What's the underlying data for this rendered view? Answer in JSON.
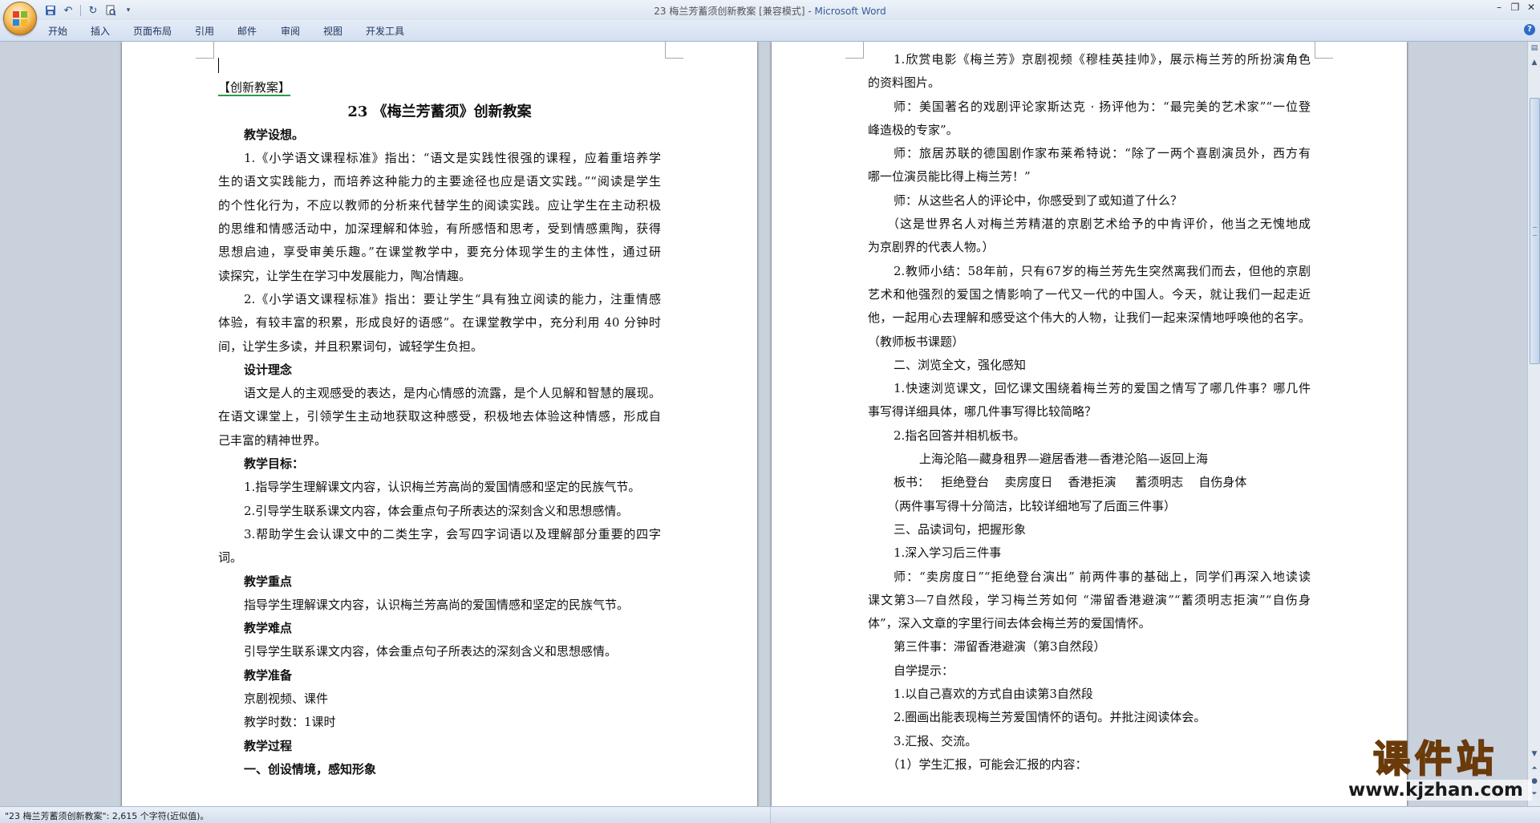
{
  "window": {
    "title": "23 梅兰芳蓄须创新教案 [兼容模式]",
    "app_name": "Microsoft Word"
  },
  "quick_access": [
    "save-icon",
    "undo-icon",
    "redo-icon",
    "print-preview-icon",
    "customize-icon"
  ],
  "ribbon": {
    "tabs": [
      "开始",
      "插入",
      "页面布局",
      "引用",
      "邮件",
      "审阅",
      "视图",
      "开发工具"
    ]
  },
  "page1": {
    "lines": [
      "【创新教案】",
      "23 《梅兰芳蓄须》创新教案",
      "教学设想。",
      "1.《小学语文课程标准》指出：“语文是实践性很强的课程，应着重培养学",
      "生的语文实践能力，而培养这种能力的主要途径也应是语文实践。”“阅读是学生",
      "的个性化行为，不应以教师的分析来代替学生的阅读实践。应让学生在主动积极",
      "的思维和情感活动中，加深理解和体验，有所感悟和思考，受到情感熏陶，获得",
      "思想启迪，享受审美乐趣。”在课堂教学中，要充分体现学生的主体性，通过研",
      "读探究，让学生在学习中发展能力，陶冶情趣。",
      "2.《小学语文课程标准》指出：要让学生“具有独立阅读的能力，注重情感",
      "体验，有较丰富的积累，形成良好的语感”。在课堂教学中，充分利用 40 分钟时",
      "间，让学生多读，并且积累词句，诚轻学生负担。",
      "设计理念",
      "语文是人的主观感受的表达，是内心情感的流露，是个人见解和智慧的展现。",
      "在语文课堂上，引领学生主动地获取这种感受，积极地去体验这种情感，形成自",
      "己丰富的精神世界。",
      "教学目标：",
      "1.指导学生理解课文内容，认识梅兰芳高尚的爱国情感和坚定的民族气节。",
      "2.引导学生联系课文内容，体会重点句子所表达的深刻含义和思想感情。",
      "3.帮助学生会认课文中的二类生字，会写四字词语以及理解部分重要的四字",
      "词。",
      "教学重点",
      "指导学生理解课文内容，认识梅兰芳高尚的爱国情感和坚定的民族气节。",
      "教学难点",
      "引导学生联系课文内容，体会重点句子所表达的深刻含义和思想感情。",
      "教学准备",
      "京剧视频、课件",
      "教学时数：1课时",
      "教学过程",
      "一、创设情境，感知形象"
    ]
  },
  "page2": {
    "lines": [
      "1.欣赏电影《梅兰芳》京剧视频《穆桂英挂帅》，展示梅兰芳的所扮演角色",
      "的资料图片。",
      "师：美国著名的戏剧评论家斯达克 · 扬评他为：“最完美的艺术家”“一位登",
      "峰造极的专家”。",
      "师：旅居苏联的德国剧作家布莱希特说：“除了一两个喜剧演员外，西方有",
      "哪一位演员能比得上梅兰芳！”",
      "师：从这些名人的评论中，你感受到了或知道了什么？",
      "（这是世界名人对梅兰芳精湛的京剧艺术给予的中肯评价，他当之无愧地成",
      "为京剧界的代表人物。）",
      "2.教师小结：58年前，只有67岁的梅兰芳先生突然离我们而去，但他的京剧",
      "艺术和他强烈的爱国之情影响了一代又一代的中国人。今天，就让我们一起走近",
      "他，一起用心去理解和感受这个伟大的人物，让我们一起来深情地呼唤他的名字。",
      "（教师板书课题）",
      "二、浏览全文，强化感知",
      "1.快速浏览课文，回忆课文围绕着梅兰芳的爱国之情写了哪几件事？哪几件",
      "事写得详细具体，哪几件事写得比较简略？",
      "2.指名回答并相机板书。",
      "上海沦陷—藏身租界—避居香港—香港沦陷—返回上海",
      "板书：   拒绝登台    卖房度日    香港拒演     蓄须明志    自伤身体",
      "（两件事写得十分简洁，比较详细地写了后面三件事）",
      "三、品读词句，把握形象",
      "1.深入学习后三件事",
      "师：“卖房度日”“拒绝登台演出” 前两件事的基础上，同学们再深入地读读",
      "课文第3—7自然段，学习梅兰芳如何 “滞留香港避演”“蓄须明志拒演”“自伤身",
      "体”，深入文章的字里行间去体会梅兰芳的爱国情怀。",
      "第三件事：滞留香港避演（第3自然段）",
      "自学提示：",
      "1.以自己喜欢的方式自由读第3自然段",
      "2.圈画出能表现梅兰芳爱国情怀的语句。并批注阅读体会。",
      "3.汇报、交流。",
      "（1）学生汇报，可能会汇报的内容："
    ]
  },
  "status": {
    "text": "\"23 梅兰芳蓄须创新教案\": 2,615 个字符(近似值)。"
  },
  "watermark": {
    "title": "课件站",
    "url": "www.kjzhan.com"
  }
}
